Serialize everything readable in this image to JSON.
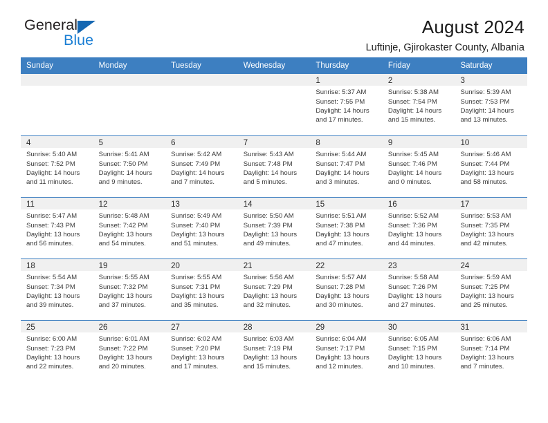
{
  "brand": {
    "name_top": "General",
    "name_bottom": "Blue",
    "triangle_color": "#1567b2",
    "blue_color": "#1b7fd4"
  },
  "header": {
    "title": "August 2024",
    "subtitle": "Luftinje, Gjirokaster County, Albania"
  },
  "theme": {
    "header_blue": "#3d7fc1",
    "band_gray": "#f0f0f0",
    "text": "#2b2b2b"
  },
  "calendar": {
    "weekday_headers": [
      "Sunday",
      "Monday",
      "Tuesday",
      "Wednesday",
      "Thursday",
      "Friday",
      "Saturday"
    ],
    "weeks": [
      [
        {
          "day": "",
          "lines": []
        },
        {
          "day": "",
          "lines": []
        },
        {
          "day": "",
          "lines": []
        },
        {
          "day": "",
          "lines": []
        },
        {
          "day": "1",
          "lines": [
            "Sunrise: 5:37 AM",
            "Sunset: 7:55 PM",
            "Daylight: 14 hours",
            "and 17 minutes."
          ]
        },
        {
          "day": "2",
          "lines": [
            "Sunrise: 5:38 AM",
            "Sunset: 7:54 PM",
            "Daylight: 14 hours",
            "and 15 minutes."
          ]
        },
        {
          "day": "3",
          "lines": [
            "Sunrise: 5:39 AM",
            "Sunset: 7:53 PM",
            "Daylight: 14 hours",
            "and 13 minutes."
          ]
        }
      ],
      [
        {
          "day": "4",
          "lines": [
            "Sunrise: 5:40 AM",
            "Sunset: 7:52 PM",
            "Daylight: 14 hours",
            "and 11 minutes."
          ]
        },
        {
          "day": "5",
          "lines": [
            "Sunrise: 5:41 AM",
            "Sunset: 7:50 PM",
            "Daylight: 14 hours",
            "and 9 minutes."
          ]
        },
        {
          "day": "6",
          "lines": [
            "Sunrise: 5:42 AM",
            "Sunset: 7:49 PM",
            "Daylight: 14 hours",
            "and 7 minutes."
          ]
        },
        {
          "day": "7",
          "lines": [
            "Sunrise: 5:43 AM",
            "Sunset: 7:48 PM",
            "Daylight: 14 hours",
            "and 5 minutes."
          ]
        },
        {
          "day": "8",
          "lines": [
            "Sunrise: 5:44 AM",
            "Sunset: 7:47 PM",
            "Daylight: 14 hours",
            "and 3 minutes."
          ]
        },
        {
          "day": "9",
          "lines": [
            "Sunrise: 5:45 AM",
            "Sunset: 7:46 PM",
            "Daylight: 14 hours",
            "and 0 minutes."
          ]
        },
        {
          "day": "10",
          "lines": [
            "Sunrise: 5:46 AM",
            "Sunset: 7:44 PM",
            "Daylight: 13 hours",
            "and 58 minutes."
          ]
        }
      ],
      [
        {
          "day": "11",
          "lines": [
            "Sunrise: 5:47 AM",
            "Sunset: 7:43 PM",
            "Daylight: 13 hours",
            "and 56 minutes."
          ]
        },
        {
          "day": "12",
          "lines": [
            "Sunrise: 5:48 AM",
            "Sunset: 7:42 PM",
            "Daylight: 13 hours",
            "and 54 minutes."
          ]
        },
        {
          "day": "13",
          "lines": [
            "Sunrise: 5:49 AM",
            "Sunset: 7:40 PM",
            "Daylight: 13 hours",
            "and 51 minutes."
          ]
        },
        {
          "day": "14",
          "lines": [
            "Sunrise: 5:50 AM",
            "Sunset: 7:39 PM",
            "Daylight: 13 hours",
            "and 49 minutes."
          ]
        },
        {
          "day": "15",
          "lines": [
            "Sunrise: 5:51 AM",
            "Sunset: 7:38 PM",
            "Daylight: 13 hours",
            "and 47 minutes."
          ]
        },
        {
          "day": "16",
          "lines": [
            "Sunrise: 5:52 AM",
            "Sunset: 7:36 PM",
            "Daylight: 13 hours",
            "and 44 minutes."
          ]
        },
        {
          "day": "17",
          "lines": [
            "Sunrise: 5:53 AM",
            "Sunset: 7:35 PM",
            "Daylight: 13 hours",
            "and 42 minutes."
          ]
        }
      ],
      [
        {
          "day": "18",
          "lines": [
            "Sunrise: 5:54 AM",
            "Sunset: 7:34 PM",
            "Daylight: 13 hours",
            "and 39 minutes."
          ]
        },
        {
          "day": "19",
          "lines": [
            "Sunrise: 5:55 AM",
            "Sunset: 7:32 PM",
            "Daylight: 13 hours",
            "and 37 minutes."
          ]
        },
        {
          "day": "20",
          "lines": [
            "Sunrise: 5:55 AM",
            "Sunset: 7:31 PM",
            "Daylight: 13 hours",
            "and 35 minutes."
          ]
        },
        {
          "day": "21",
          "lines": [
            "Sunrise: 5:56 AM",
            "Sunset: 7:29 PM",
            "Daylight: 13 hours",
            "and 32 minutes."
          ]
        },
        {
          "day": "22",
          "lines": [
            "Sunrise: 5:57 AM",
            "Sunset: 7:28 PM",
            "Daylight: 13 hours",
            "and 30 minutes."
          ]
        },
        {
          "day": "23",
          "lines": [
            "Sunrise: 5:58 AM",
            "Sunset: 7:26 PM",
            "Daylight: 13 hours",
            "and 27 minutes."
          ]
        },
        {
          "day": "24",
          "lines": [
            "Sunrise: 5:59 AM",
            "Sunset: 7:25 PM",
            "Daylight: 13 hours",
            "and 25 minutes."
          ]
        }
      ],
      [
        {
          "day": "25",
          "lines": [
            "Sunrise: 6:00 AM",
            "Sunset: 7:23 PM",
            "Daylight: 13 hours",
            "and 22 minutes."
          ]
        },
        {
          "day": "26",
          "lines": [
            "Sunrise: 6:01 AM",
            "Sunset: 7:22 PM",
            "Daylight: 13 hours",
            "and 20 minutes."
          ]
        },
        {
          "day": "27",
          "lines": [
            "Sunrise: 6:02 AM",
            "Sunset: 7:20 PM",
            "Daylight: 13 hours",
            "and 17 minutes."
          ]
        },
        {
          "day": "28",
          "lines": [
            "Sunrise: 6:03 AM",
            "Sunset: 7:19 PM",
            "Daylight: 13 hours",
            "and 15 minutes."
          ]
        },
        {
          "day": "29",
          "lines": [
            "Sunrise: 6:04 AM",
            "Sunset: 7:17 PM",
            "Daylight: 13 hours",
            "and 12 minutes."
          ]
        },
        {
          "day": "30",
          "lines": [
            "Sunrise: 6:05 AM",
            "Sunset: 7:15 PM",
            "Daylight: 13 hours",
            "and 10 minutes."
          ]
        },
        {
          "day": "31",
          "lines": [
            "Sunrise: 6:06 AM",
            "Sunset: 7:14 PM",
            "Daylight: 13 hours",
            "and 7 minutes."
          ]
        }
      ]
    ]
  }
}
